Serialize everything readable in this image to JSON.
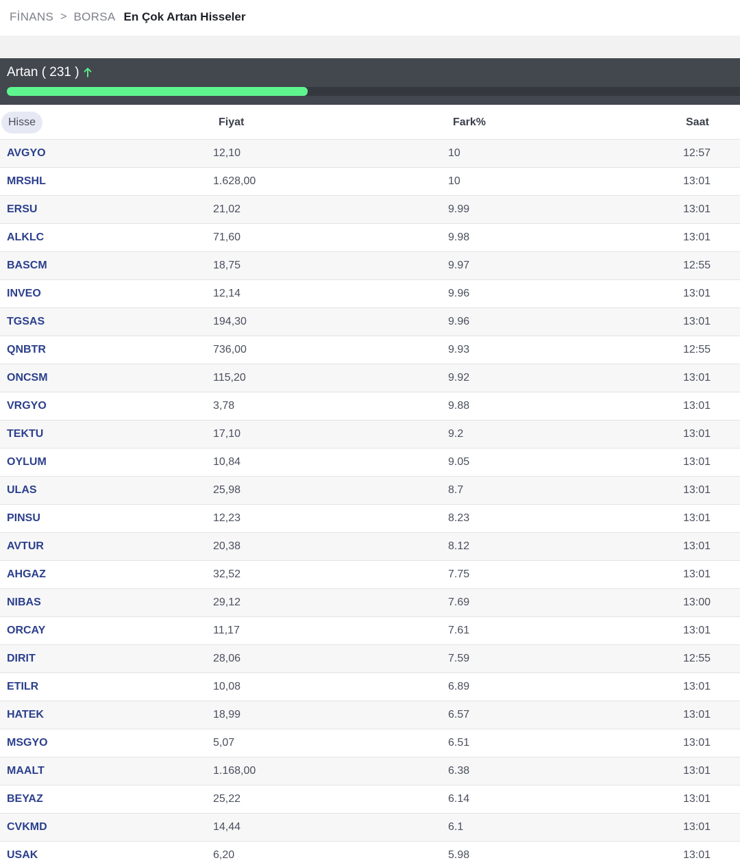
{
  "breadcrumb": {
    "items": [
      "FİNANS",
      "BORSA"
    ],
    "separator": ">",
    "current": "En Çok Artan Hisseler"
  },
  "summary": {
    "label": "Artan ( 231 )",
    "arrow_icon": "arrow-up-icon",
    "arrow_color": "#5ef58f",
    "progress_fraction": 0.41,
    "progress_color": "#5ef58f"
  },
  "table": {
    "columns": [
      "Hisse",
      "Fiyat",
      "Fark%",
      "Saat"
    ],
    "rows": [
      {
        "hisse": "AVGYO",
        "fiyat": "12,10",
        "fark": "10",
        "saat": "12:57"
      },
      {
        "hisse": "MRSHL",
        "fiyat": "1.628,00",
        "fark": "10",
        "saat": "13:01"
      },
      {
        "hisse": "ERSU",
        "fiyat": "21,02",
        "fark": "9.99",
        "saat": "13:01"
      },
      {
        "hisse": "ALKLC",
        "fiyat": "71,60",
        "fark": "9.98",
        "saat": "13:01"
      },
      {
        "hisse": "BASCM",
        "fiyat": "18,75",
        "fark": "9.97",
        "saat": "12:55"
      },
      {
        "hisse": "INVEO",
        "fiyat": "12,14",
        "fark": "9.96",
        "saat": "13:01"
      },
      {
        "hisse": "TGSAS",
        "fiyat": "194,30",
        "fark": "9.96",
        "saat": "13:01"
      },
      {
        "hisse": "QNBTR",
        "fiyat": "736,00",
        "fark": "9.93",
        "saat": "12:55"
      },
      {
        "hisse": "ONCSM",
        "fiyat": "115,20",
        "fark": "9.92",
        "saat": "13:01"
      },
      {
        "hisse": "VRGYO",
        "fiyat": "3,78",
        "fark": "9.88",
        "saat": "13:01"
      },
      {
        "hisse": "TEKTU",
        "fiyat": "17,10",
        "fark": "9.2",
        "saat": "13:01"
      },
      {
        "hisse": "OYLUM",
        "fiyat": "10,84",
        "fark": "9.05",
        "saat": "13:01"
      },
      {
        "hisse": "ULAS",
        "fiyat": "25,98",
        "fark": "8.7",
        "saat": "13:01"
      },
      {
        "hisse": "PINSU",
        "fiyat": "12,23",
        "fark": "8.23",
        "saat": "13:01"
      },
      {
        "hisse": "AVTUR",
        "fiyat": "20,38",
        "fark": "8.12",
        "saat": "13:01"
      },
      {
        "hisse": "AHGAZ",
        "fiyat": "32,52",
        "fark": "7.75",
        "saat": "13:01"
      },
      {
        "hisse": "NIBAS",
        "fiyat": "29,12",
        "fark": "7.69",
        "saat": "13:00"
      },
      {
        "hisse": "ORCAY",
        "fiyat": "11,17",
        "fark": "7.61",
        "saat": "13:01"
      },
      {
        "hisse": "DIRIT",
        "fiyat": "28,06",
        "fark": "7.59",
        "saat": "12:55"
      },
      {
        "hisse": "ETILR",
        "fiyat": "10,08",
        "fark": "6.89",
        "saat": "13:01"
      },
      {
        "hisse": "HATEK",
        "fiyat": "18,99",
        "fark": "6.57",
        "saat": "13:01"
      },
      {
        "hisse": "MSGYO",
        "fiyat": "5,07",
        "fark": "6.51",
        "saat": "13:01"
      },
      {
        "hisse": "MAALT",
        "fiyat": "1.168,00",
        "fark": "6.38",
        "saat": "13:01"
      },
      {
        "hisse": "BEYAZ",
        "fiyat": "25,22",
        "fark": "6.14",
        "saat": "13:01"
      },
      {
        "hisse": "CVKMD",
        "fiyat": "14,44",
        "fark": "6.1",
        "saat": "13:01"
      },
      {
        "hisse": "USAK",
        "fiyat": "6,20",
        "fark": "5.98",
        "saat": "13:01"
      }
    ]
  }
}
